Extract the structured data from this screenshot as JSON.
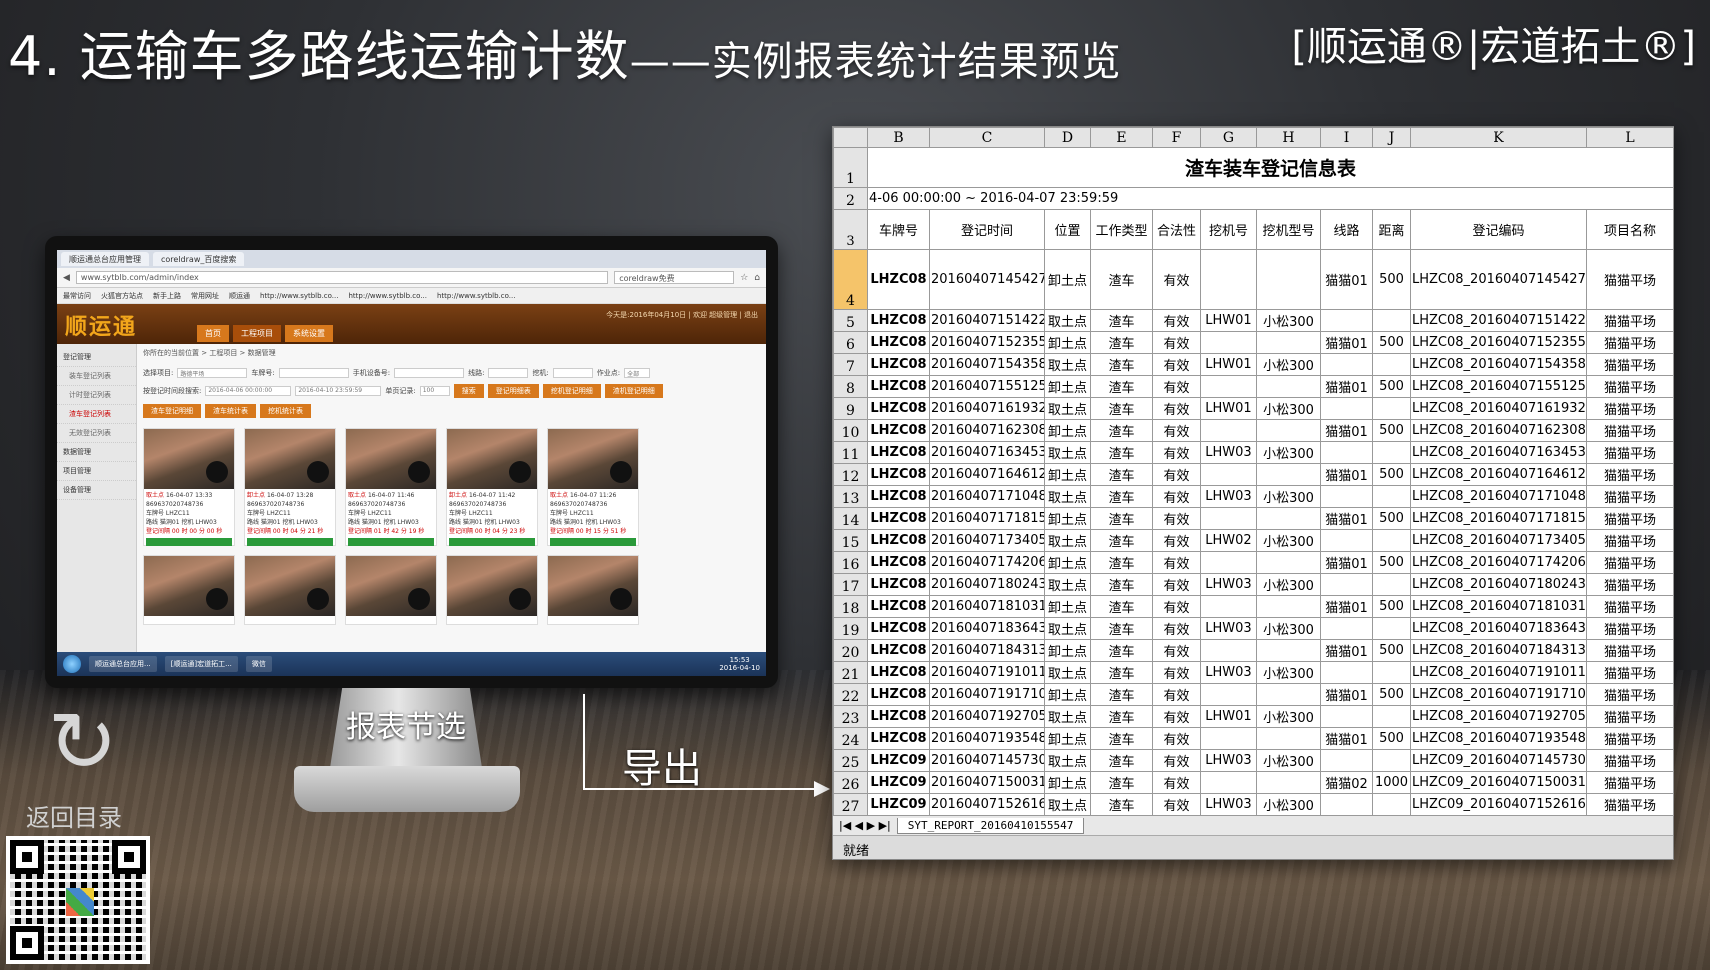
{
  "slide": {
    "title_main": "4. 运输车多路线运输计数",
    "title_sub": "——实例报表统计结果预览",
    "brand": "[顺运通®|宏道拓土®]",
    "back_label": "返回目录",
    "filter_label": "报表节选",
    "export_label": "导出"
  },
  "browser": {
    "tabs": [
      "顺运通总台应用管理",
      "coreldraw_百度搜索"
    ],
    "address": "www.sytblb.com/admin/index",
    "search": "coreldraw免费",
    "bookmarks": [
      "最常访问",
      "火狐官方站点",
      "新手上路",
      "常用网址",
      "顺运通",
      "http://www.sytblb.co...",
      "http://www.sytblb.co...",
      "http://www.sytblb.co..."
    ]
  },
  "app": {
    "logo": "顺运通",
    "info": "今天是:2016年04月10日 | 欢迎 超级管理 | 退出",
    "nav": [
      "首页",
      "工程项目",
      "系统设置"
    ],
    "sidebar": [
      "登记管理",
      "装车登记列表",
      "计时登记列表",
      "渣车登记列表",
      "无效登记列表",
      "数据管理",
      "项目管理",
      "设备管理"
    ],
    "crumb": "你所在的当前位置 > 工程项目 > 数据管理",
    "filters": {
      "project": "选择项目:",
      "project_value": "路德平场",
      "plate": "车牌号:",
      "device": "手机设备号:",
      "route": "线路:",
      "machine": "挖机:",
      "workpoint": "作业点:",
      "workpoint_value": "全部",
      "time": "按登记时间段搜索:",
      "time_from": "2016-04-06 00:00:00",
      "time_to": "2016-04-10 23:59:59",
      "count": "单页记录:",
      "count_value": "100"
    },
    "buttons": [
      "搜索",
      "登记明细表",
      "挖机登记明细",
      "渣机登记明细",
      "渣车登记明细",
      "渣车统计表",
      "挖机统计表"
    ],
    "photos": [
      {
        "tag": "取土点",
        "time": "16-04-07 13:33",
        "device": "869637020748736",
        "plate": "车牌号 LHZC11",
        "route": "路线 猫洞01 挖机 LHW03",
        "interval": "登记间隔 00 时 00 分 00 秒"
      },
      {
        "tag": "卸土点",
        "time": "16-04-07 13:28",
        "device": "869637020748736",
        "plate": "车牌号 LHZC11",
        "route": "路线 猫洞01 挖机 LHW03",
        "interval": "登记间隔 00 时 04 分 21 秒"
      },
      {
        "tag": "取土点",
        "time": "16-04-07 11:46",
        "device": "869637020748736",
        "plate": "车牌号 LHZC11",
        "route": "路线 猫洞01 挖机 LHW03",
        "interval": "登记间隔 01 时 42 分 19 秒"
      },
      {
        "tag": "卸土点",
        "time": "16-04-07 11:42",
        "device": "869637020748736",
        "plate": "车牌号 LHZC11",
        "route": "路线 猫洞01 挖机 LHW03",
        "interval": "登记间隔 00 时 04 分 23 秒"
      },
      {
        "tag": "取土点",
        "time": "16-04-07 11:26",
        "device": "869637020748736",
        "plate": "车牌号 LHZC11",
        "route": "路线 猫洞01 挖机 LHW03",
        "interval": "登记间隔 00 时 15 分 51 秒"
      }
    ],
    "taskbar": [
      "顺运通总台应用...",
      "[顺运通]宏道拓工...",
      "微信"
    ],
    "clock_time": "15:53",
    "clock_date": "2016-04-10"
  },
  "sheet": {
    "col_letters": [
      "B",
      "C",
      "D",
      "E",
      "F",
      "G",
      "H",
      "I",
      "J",
      "K",
      "L"
    ],
    "title": "渣车装车登记信息表",
    "range": "4-06 00:00:00 ~ 2016-04-07 23:59:59",
    "headers": [
      "车牌号",
      "登记时间",
      "位置",
      "工作类型",
      "合法性",
      "挖机号",
      "挖机型号",
      "线路",
      "距离",
      "登记编码",
      "项目名称"
    ],
    "rows": [
      [
        "4",
        "LHZC08",
        "20160407145427",
        "卸土点",
        "渣车",
        "有效",
        "",
        "",
        "猫猫01",
        "500",
        "LHZC08_20160407145427",
        "猫猫平场"
      ],
      [
        "5",
        "LHZC08",
        "20160407151422",
        "取土点",
        "渣车",
        "有效",
        "LHW01",
        "小松300",
        "",
        "",
        "LHZC08_20160407151422",
        "猫猫平场"
      ],
      [
        "6",
        "LHZC08",
        "20160407152355",
        "卸土点",
        "渣车",
        "有效",
        "",
        "",
        "猫猫01",
        "500",
        "LHZC08_20160407152355",
        "猫猫平场"
      ],
      [
        "7",
        "LHZC08",
        "20160407154358",
        "取土点",
        "渣车",
        "有效",
        "LHW01",
        "小松300",
        "",
        "",
        "LHZC08_20160407154358",
        "猫猫平场"
      ],
      [
        "8",
        "LHZC08",
        "20160407155125",
        "卸土点",
        "渣车",
        "有效",
        "",
        "",
        "猫猫01",
        "500",
        "LHZC08_20160407155125",
        "猫猫平场"
      ],
      [
        "9",
        "LHZC08",
        "20160407161932",
        "取土点",
        "渣车",
        "有效",
        "LHW01",
        "小松300",
        "",
        "",
        "LHZC08_20160407161932",
        "猫猫平场"
      ],
      [
        "10",
        "LHZC08",
        "20160407162308",
        "卸土点",
        "渣车",
        "有效",
        "",
        "",
        "猫猫01",
        "500",
        "LHZC08_20160407162308",
        "猫猫平场"
      ],
      [
        "11",
        "LHZC08",
        "20160407163453",
        "取土点",
        "渣车",
        "有效",
        "LHW03",
        "小松300",
        "",
        "",
        "LHZC08_20160407163453",
        "猫猫平场"
      ],
      [
        "12",
        "LHZC08",
        "20160407164612",
        "卸土点",
        "渣车",
        "有效",
        "",
        "",
        "猫猫01",
        "500",
        "LHZC08_20160407164612",
        "猫猫平场"
      ],
      [
        "13",
        "LHZC08",
        "20160407171048",
        "取土点",
        "渣车",
        "有效",
        "LHW03",
        "小松300",
        "",
        "",
        "LHZC08_20160407171048",
        "猫猫平场"
      ],
      [
        "14",
        "LHZC08",
        "20160407171815",
        "卸土点",
        "渣车",
        "有效",
        "",
        "",
        "猫猫01",
        "500",
        "LHZC08_20160407171815",
        "猫猫平场"
      ],
      [
        "15",
        "LHZC08",
        "20160407173405",
        "取土点",
        "渣车",
        "有效",
        "LHW02",
        "小松300",
        "",
        "",
        "LHZC08_20160407173405",
        "猫猫平场"
      ],
      [
        "16",
        "LHZC08",
        "20160407174206",
        "卸土点",
        "渣车",
        "有效",
        "",
        "",
        "猫猫01",
        "500",
        "LHZC08_20160407174206",
        "猫猫平场"
      ],
      [
        "17",
        "LHZC08",
        "20160407180243",
        "取土点",
        "渣车",
        "有效",
        "LHW03",
        "小松300",
        "",
        "",
        "LHZC08_20160407180243",
        "猫猫平场"
      ],
      [
        "18",
        "LHZC08",
        "20160407181031",
        "卸土点",
        "渣车",
        "有效",
        "",
        "",
        "猫猫01",
        "500",
        "LHZC08_20160407181031",
        "猫猫平场"
      ],
      [
        "19",
        "LHZC08",
        "20160407183643",
        "取土点",
        "渣车",
        "有效",
        "LHW03",
        "小松300",
        "",
        "",
        "LHZC08_20160407183643",
        "猫猫平场"
      ],
      [
        "20",
        "LHZC08",
        "20160407184313",
        "卸土点",
        "渣车",
        "有效",
        "",
        "",
        "猫猫01",
        "500",
        "LHZC08_20160407184313",
        "猫猫平场"
      ],
      [
        "21",
        "LHZC08",
        "20160407191011",
        "取土点",
        "渣车",
        "有效",
        "LHW03",
        "小松300",
        "",
        "",
        "LHZC08_20160407191011",
        "猫猫平场"
      ],
      [
        "22",
        "LHZC08",
        "20160407191710",
        "卸土点",
        "渣车",
        "有效",
        "",
        "",
        "猫猫01",
        "500",
        "LHZC08_20160407191710",
        "猫猫平场"
      ],
      [
        "23",
        "LHZC08",
        "20160407192705",
        "取土点",
        "渣车",
        "有效",
        "LHW01",
        "小松300",
        "",
        "",
        "LHZC08_20160407192705",
        "猫猫平场"
      ],
      [
        "24",
        "LHZC08",
        "20160407193548",
        "卸土点",
        "渣车",
        "有效",
        "",
        "",
        "猫猫01",
        "500",
        "LHZC08_20160407193548",
        "猫猫平场"
      ],
      [
        "25",
        "LHZC09",
        "20160407145730",
        "取土点",
        "渣车",
        "有效",
        "LHW03",
        "小松300",
        "",
        "",
        "LHZC09_20160407145730",
        "猫猫平场"
      ],
      [
        "26",
        "LHZC09",
        "20160407150031",
        "卸土点",
        "渣车",
        "有效",
        "",
        "",
        "猫猫02",
        "1000",
        "LHZC09_20160407150031",
        "猫猫平场"
      ],
      [
        "27",
        "LHZC09",
        "20160407152616",
        "取土点",
        "渣车",
        "有效",
        "LHW03",
        "小松300",
        "",
        "",
        "LHZC09_20160407152616",
        "猫猫平场"
      ]
    ],
    "sheet_tab": "SYT_REPORT_20160410155547",
    "status": "就绪"
  }
}
